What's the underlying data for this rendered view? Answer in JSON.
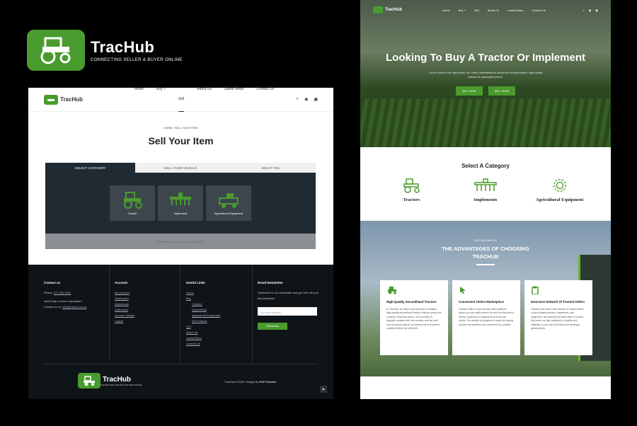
{
  "brand": {
    "name": "TracHub",
    "tagline": "CONNECTING SELLER & BUYER ONLINE"
  },
  "left": {
    "nav": [
      "Home",
      "Buy",
      "Sell",
      "About Us",
      "Latest News",
      "Contact Us"
    ],
    "breadcrumb": "HOME  /  SELL YOUR ITEM",
    "title": "Sell Your Item",
    "tabs": [
      "SELECT CATEGORY",
      "SELL YOUR VEHICLE",
      "ABOUT YOU"
    ],
    "categories": [
      "Tractor",
      "Implement",
      "Agricultural Equipment"
    ],
    "help": "Need Help? Call us on: 0712345678",
    "footer": {
      "contact": {
        "title": "Contact us",
        "phone_label": "Phone:",
        "phone": "071 234 5787",
        "help": "Need help or have a question?",
        "email_label": "Contact us at:",
        "email": "info@trachub.co.za"
      },
      "account": {
        "title": "Account",
        "links": [
          "My Account",
          "Dashboard",
          "Downloads",
          "Addresses",
          "Account Details",
          "Logout"
        ]
      },
      "useful": {
        "title": "Useful Links",
        "links": [
          "Home",
          "Buy",
          "Tractors",
          "Implements",
          "Agricultural Equipment",
          "All Products",
          "Sell",
          "About Us",
          "Latest News",
          "Contact Us"
        ]
      },
      "newsletter": {
        "title": "Email Newsletter",
        "text": "Subscribe to our newsletter and get 10% off your first purchase",
        "placeholder": "Your email address",
        "button": "Subscribe"
      },
      "copyright": "TracHub ©2023. Design By",
      "designer": "EXP Studios"
    }
  },
  "right": {
    "nav": [
      "Home",
      "Buy",
      "Sell",
      "About Us",
      "Latest News",
      "Contact Us"
    ],
    "hero": {
      "title": "Looking To Buy A Tractor Or Implement",
      "subtitle": "You've come to the right place! Our online marketplace is perfect for finding reliable, high-quality tractors at reasonable prices.",
      "buy": "BUY NOW",
      "sell": "SELL NOW"
    },
    "select": {
      "title": "Select A Category",
      "items": [
        "Tractors",
        "Implements",
        "Agricultural Equipment"
      ]
    },
    "advantages": {
      "kicker": "WHY CHOOSE US?",
      "title1": "THE ADVANTAGES OF CHOOSING",
      "title2": "TRACHUB",
      "cards": [
        {
          "title": "High-Quality Secondhand Tractors",
          "text": "At TracHub, we offer a vast selection of reliable, high-quality secondhand tractors that are perfect for a variety of farming needs. Our inventory is regularly updated with new models, and we work hard to ensure that all our tractors are in excellent condition before we sell them."
        },
        {
          "title": "Convenient Online Marketplace",
          "text": "TracHub offers a user-friendly online platform where you can easily search for and find the perfect tractor, implement or equipment to meet your needs. Our website is designed to make the buying process as seamless and convenient as possible."
        },
        {
          "title": "Extensive Network Of Trusted Sellers",
          "text": "TracHub has built a vast network of trusted sellers of secondhand tractors, implements, and equipment. We carefully vet each seller to ensure they meet our high standards of quality and reliability, so you can trust that you're getting a great product."
        }
      ]
    }
  },
  "colors": {
    "accent": "#4a9b2e",
    "dark": "#1f2a33"
  }
}
